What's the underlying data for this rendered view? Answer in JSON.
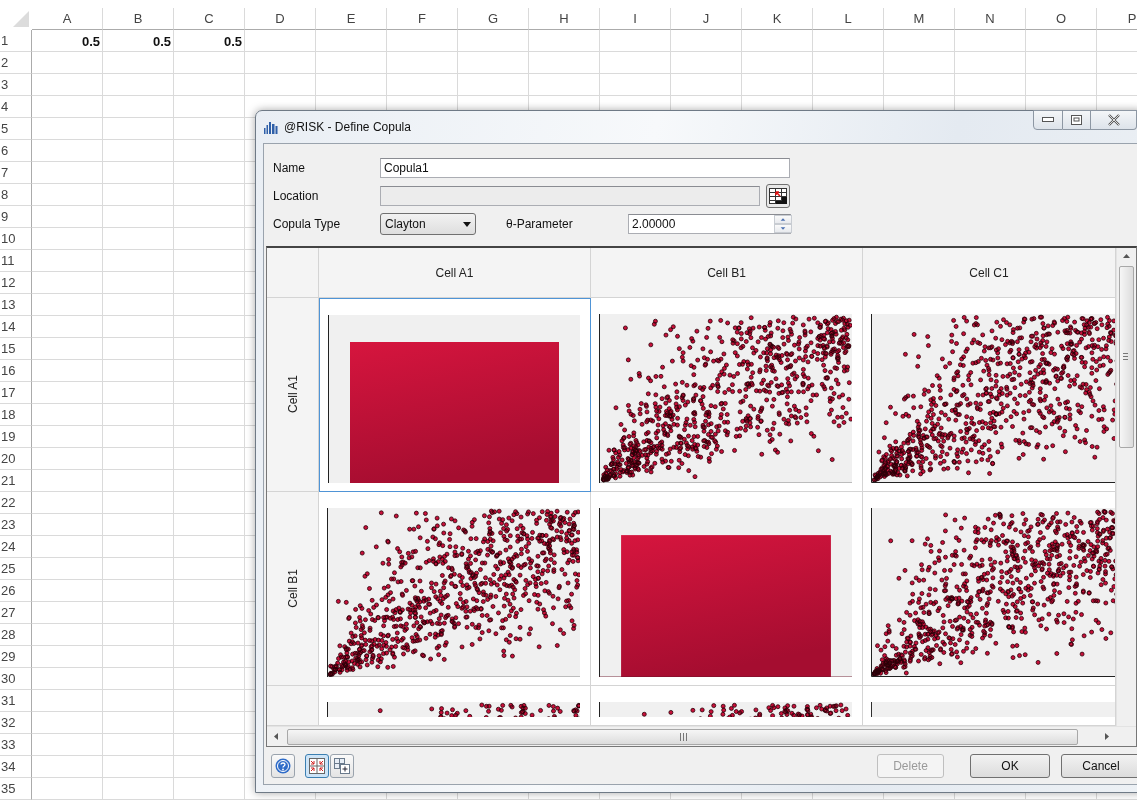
{
  "spreadsheet": {
    "columns": [
      "A",
      "B",
      "C",
      "D",
      "E",
      "F",
      "G",
      "H",
      "I",
      "J",
      "K",
      "L",
      "M",
      "N",
      "O",
      "P"
    ],
    "rows": [
      {
        "number": "1",
        "values": [
          "0.5",
          "0.5",
          "0.5"
        ]
      },
      {
        "number": "2"
      },
      {
        "number": "3"
      },
      {
        "number": "4"
      },
      {
        "number": "5"
      },
      {
        "number": "6"
      },
      {
        "number": "7"
      },
      {
        "number": "8"
      },
      {
        "number": "9"
      },
      {
        "number": "10"
      },
      {
        "number": "11"
      },
      {
        "number": "12"
      },
      {
        "number": "13"
      },
      {
        "number": "14"
      },
      {
        "number": "15"
      },
      {
        "number": "16"
      },
      {
        "number": "17"
      },
      {
        "number": "18"
      },
      {
        "number": "19"
      },
      {
        "number": "20"
      },
      {
        "number": "21"
      },
      {
        "number": "22"
      },
      {
        "number": "23"
      },
      {
        "number": "24"
      },
      {
        "number": "25"
      },
      {
        "number": "26"
      },
      {
        "number": "27"
      },
      {
        "number": "28"
      },
      {
        "number": "29"
      },
      {
        "number": "30"
      },
      {
        "number": "31"
      },
      {
        "number": "32"
      },
      {
        "number": "33"
      },
      {
        "number": "34"
      },
      {
        "number": "35"
      }
    ]
  },
  "dialog": {
    "title": "@RISK - Define Copula",
    "name": {
      "label": "Name",
      "value": "Copula1"
    },
    "location": {
      "label": "Location",
      "disabled": true
    },
    "copula_type": {
      "label": "Copula Type",
      "value": "Clayton"
    },
    "theta": {
      "label": "θ-Parameter",
      "value": "2.00000"
    },
    "matrix": {
      "columns": [
        "Cell A1",
        "Cell B1",
        "Cell C1"
      ],
      "rows": [
        {
          "label": "Cell A1",
          "cells": [
            {
              "kind": "histogram",
              "selected": true
            },
            {
              "kind": "scatter",
              "selected": false
            },
            {
              "kind": "scatter",
              "selected": false
            }
          ]
        },
        {
          "label": "Cell B1",
          "cells": [
            {
              "kind": "scatter",
              "selected": false
            },
            {
              "kind": "histogram",
              "selected": false
            },
            {
              "kind": "scatter",
              "selected": false
            }
          ]
        },
        {
          "cells": [
            {
              "kind": "scatter",
              "selected": false
            },
            {
              "kind": "scatter",
              "selected": false
            },
            {
              "kind": "histogram",
              "selected": false
            }
          ]
        }
      ]
    },
    "view_toggles": [
      {
        "kind": "matrix",
        "selected": true
      },
      {
        "kind": "add",
        "selected": false
      }
    ],
    "buttons": [
      {
        "label": "Delete",
        "disabled": true
      },
      {
        "label": "OK",
        "disabled": false
      },
      {
        "label": "Cancel",
        "disabled": false
      }
    ]
  }
}
